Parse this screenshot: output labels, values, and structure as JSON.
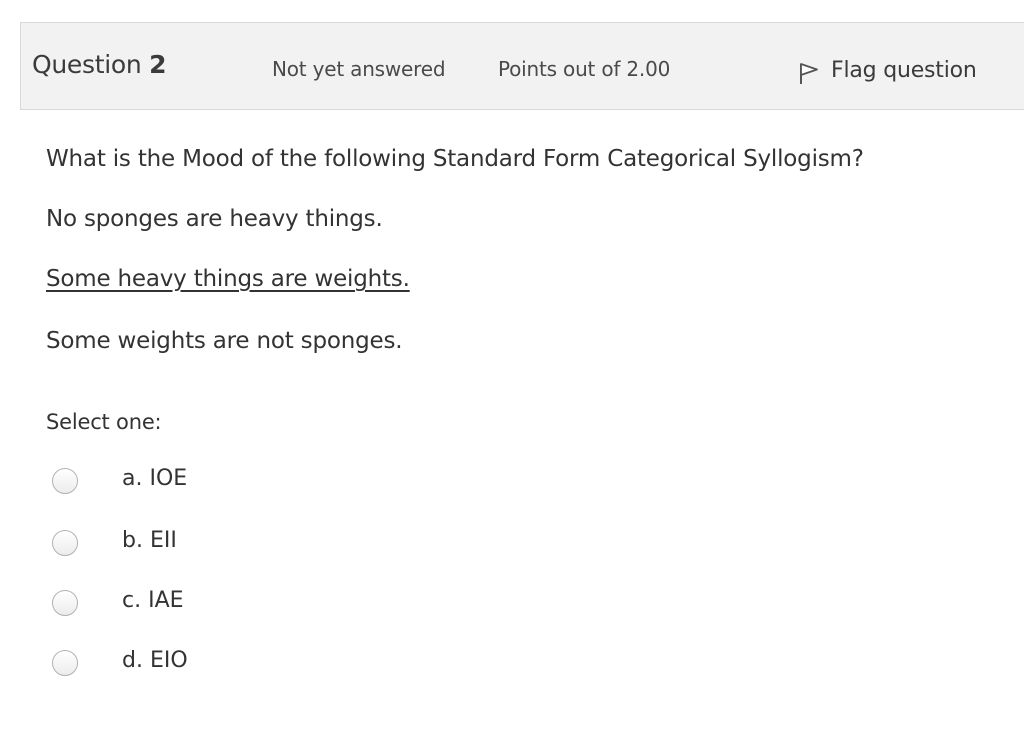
{
  "info": {
    "question_word": "Question",
    "question_number": "2",
    "status": "Not yet answered",
    "points": "Points out of 2.00",
    "flag_label": "Flag question",
    "flag_icon": "flag-icon"
  },
  "question": {
    "prompt": "What is the Mood of the following Standard Form Categorical Syllogism?",
    "premise1": "No sponges are heavy things.",
    "premise2": "Some heavy things are weights.",
    "conclusion": "Some weights are not sponges."
  },
  "answer": {
    "select_label": "Select one:",
    "options": [
      {
        "label": "a. IOE",
        "selected": false
      },
      {
        "label": "b. EII",
        "selected": false
      },
      {
        "label": "c. IAE",
        "selected": false
      },
      {
        "label": "d. EIO",
        "selected": false
      }
    ]
  },
  "colors": {
    "info_bar_bg": "#f2f2f2",
    "info_bar_border": "#d9d9d9",
    "text": "#333333"
  }
}
